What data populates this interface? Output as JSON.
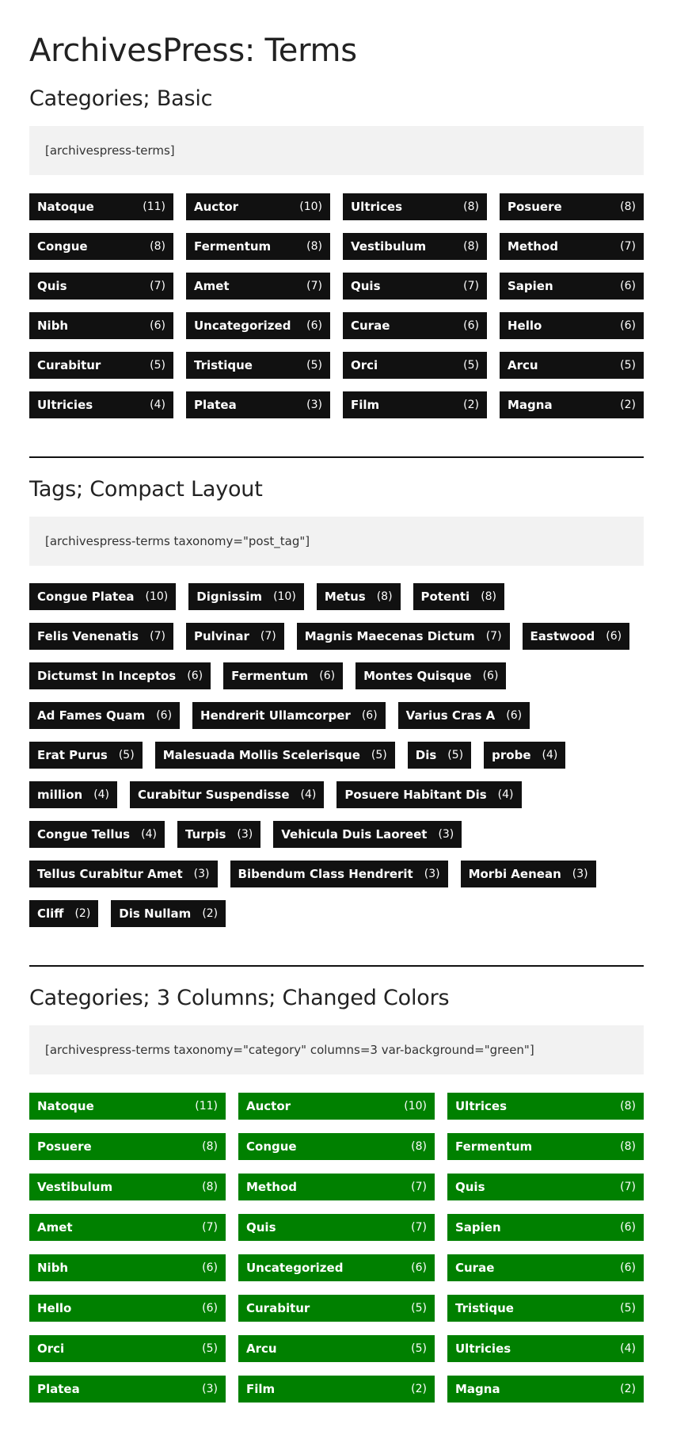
{
  "page_title": "ArchivesPress: Terms",
  "sections": [
    {
      "heading": "Categories; Basic",
      "code": "[archivespress-terms]",
      "items": [
        {
          "name": "Natoque",
          "count": "(11)"
        },
        {
          "name": "Auctor",
          "count": "(10)"
        },
        {
          "name": "Ultrices",
          "count": "(8)"
        },
        {
          "name": "Posuere",
          "count": "(8)"
        },
        {
          "name": "Congue",
          "count": "(8)"
        },
        {
          "name": "Fermentum",
          "count": "(8)"
        },
        {
          "name": "Vestibulum",
          "count": "(8)"
        },
        {
          "name": "Method",
          "count": "(7)"
        },
        {
          "name": "Quis",
          "count": "(7)"
        },
        {
          "name": "Amet",
          "count": "(7)"
        },
        {
          "name": "Quis",
          "count": "(7)"
        },
        {
          "name": "Sapien",
          "count": "(6)"
        },
        {
          "name": "Nibh",
          "count": "(6)"
        },
        {
          "name": "Uncategorized",
          "count": "(6)"
        },
        {
          "name": "Curae",
          "count": "(6)"
        },
        {
          "name": "Hello",
          "count": "(6)"
        },
        {
          "name": "Curabitur",
          "count": "(5)"
        },
        {
          "name": "Tristique",
          "count": "(5)"
        },
        {
          "name": "Orci",
          "count": "(5)"
        },
        {
          "name": "Arcu",
          "count": "(5)"
        },
        {
          "name": "Ultricies",
          "count": "(4)"
        },
        {
          "name": "Platea",
          "count": "(3)"
        },
        {
          "name": "Film",
          "count": "(2)"
        },
        {
          "name": "Magna",
          "count": "(2)"
        }
      ]
    },
    {
      "heading": "Tags; Compact Layout",
      "code": "[archivespress-terms taxonomy=\"post_tag\"]",
      "items": [
        {
          "name": "Congue Platea",
          "count": "(10)"
        },
        {
          "name": "Dignissim",
          "count": "(10)"
        },
        {
          "name": "Metus",
          "count": "(8)"
        },
        {
          "name": "Potenti",
          "count": "(8)"
        },
        {
          "name": "Felis Venenatis",
          "count": "(7)"
        },
        {
          "name": "Pulvinar",
          "count": "(7)"
        },
        {
          "name": "Magnis Maecenas Dictum",
          "count": "(7)"
        },
        {
          "name": "Eastwood",
          "count": "(6)"
        },
        {
          "name": "Dictumst In Inceptos",
          "count": "(6)"
        },
        {
          "name": "Fermentum",
          "count": "(6)"
        },
        {
          "name": "Montes Quisque",
          "count": "(6)"
        },
        {
          "name": "Ad Fames Quam",
          "count": "(6)"
        },
        {
          "name": "Hendrerit Ullamcorper",
          "count": "(6)"
        },
        {
          "name": "Varius Cras A",
          "count": "(6)"
        },
        {
          "name": "Erat Purus",
          "count": "(5)"
        },
        {
          "name": "Malesuada Mollis Scelerisque",
          "count": "(5)"
        },
        {
          "name": "Dis",
          "count": "(5)"
        },
        {
          "name": "probe",
          "count": "(4)"
        },
        {
          "name": "million",
          "count": "(4)"
        },
        {
          "name": "Curabitur Suspendisse",
          "count": "(4)"
        },
        {
          "name": "Posuere Habitant Dis",
          "count": "(4)"
        },
        {
          "name": "Congue Tellus",
          "count": "(4)"
        },
        {
          "name": "Turpis",
          "count": "(3)"
        },
        {
          "name": "Vehicula Duis Laoreet",
          "count": "(3)"
        },
        {
          "name": "Tellus Curabitur Amet",
          "count": "(3)"
        },
        {
          "name": "Bibendum Class Hendrerit",
          "count": "(3)"
        },
        {
          "name": "Morbi Aenean",
          "count": "(3)"
        },
        {
          "name": "Cliff",
          "count": "(2)"
        },
        {
          "name": "Dis Nullam",
          "count": "(2)"
        }
      ]
    },
    {
      "heading": "Categories; 3 Columns; Changed Colors",
      "code": "[archivespress-terms taxonomy=\"category\" columns=3 var-background=\"green\"]",
      "items": [
        {
          "name": "Natoque",
          "count": "(11)"
        },
        {
          "name": "Auctor",
          "count": "(10)"
        },
        {
          "name": "Ultrices",
          "count": "(8)"
        },
        {
          "name": "Posuere",
          "count": "(8)"
        },
        {
          "name": "Congue",
          "count": "(8)"
        },
        {
          "name": "Fermentum",
          "count": "(8)"
        },
        {
          "name": "Vestibulum",
          "count": "(8)"
        },
        {
          "name": "Method",
          "count": "(7)"
        },
        {
          "name": "Quis",
          "count": "(7)"
        },
        {
          "name": "Amet",
          "count": "(7)"
        },
        {
          "name": "Quis",
          "count": "(7)"
        },
        {
          "name": "Sapien",
          "count": "(6)"
        },
        {
          "name": "Nibh",
          "count": "(6)"
        },
        {
          "name": "Uncategorized",
          "count": "(6)"
        },
        {
          "name": "Curae",
          "count": "(6)"
        },
        {
          "name": "Hello",
          "count": "(6)"
        },
        {
          "name": "Curabitur",
          "count": "(5)"
        },
        {
          "name": "Tristique",
          "count": "(5)"
        },
        {
          "name": "Orci",
          "count": "(5)"
        },
        {
          "name": "Arcu",
          "count": "(5)"
        },
        {
          "name": "Ultricies",
          "count": "(4)"
        },
        {
          "name": "Platea",
          "count": "(3)"
        },
        {
          "name": "Film",
          "count": "(2)"
        },
        {
          "name": "Magna",
          "count": "(2)"
        }
      ]
    }
  ],
  "colors": {
    "dark": "#111111",
    "green": "#008000",
    "code_bg": "#f2f2f2"
  }
}
